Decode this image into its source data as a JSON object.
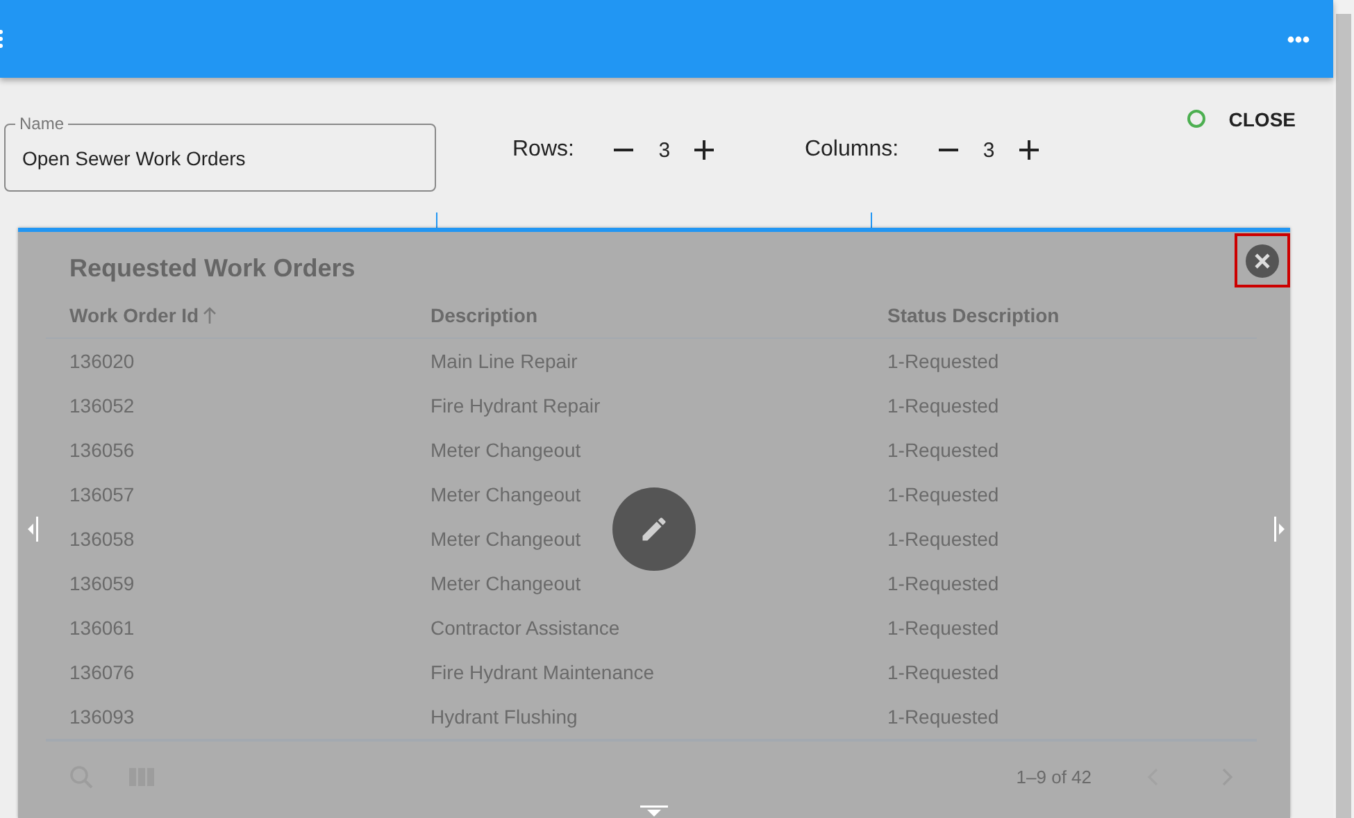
{
  "config": {
    "name_field": {
      "label": "Name",
      "value": "Open Sewer Work Orders"
    },
    "rows": {
      "label": "Rows:",
      "value": "3"
    },
    "columns": {
      "label": "Columns:",
      "value": "3"
    },
    "close_button": "CLOSE"
  },
  "widget": {
    "title": "Requested Work Orders",
    "close_highlighted": true,
    "columns": [
      {
        "label": "Work Order Id",
        "sorted": true
      },
      {
        "label": "Description",
        "sorted": false
      },
      {
        "label": "Status Description",
        "sorted": false
      }
    ],
    "rows": [
      [
        "136020",
        "Main Line Repair",
        "1-Requested"
      ],
      [
        "136052",
        "Fire Hydrant Repair",
        "1-Requested"
      ],
      [
        "136056",
        "Meter Changeout",
        "1-Requested"
      ],
      [
        "136057",
        "Meter Changeout",
        "1-Requested"
      ],
      [
        "136058",
        "Meter Changeout",
        "1-Requested"
      ],
      [
        "136059",
        "Meter Changeout",
        "1-Requested"
      ],
      [
        "136061",
        "Contractor Assistance",
        "1-Requested"
      ],
      [
        "136076",
        "Fire Hydrant Maintenance",
        "1-Requested"
      ],
      [
        "136093",
        "Hydrant Flushing",
        "1-Requested"
      ]
    ],
    "pagination": "1–9 of 42"
  }
}
